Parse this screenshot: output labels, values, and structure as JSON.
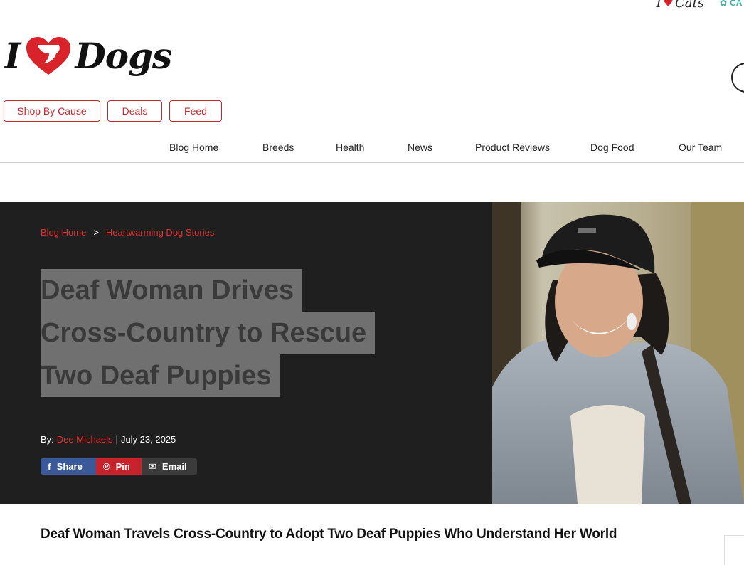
{
  "top_logos": {
    "cats_text": "Cats",
    "cat_brand_text": "CA"
  },
  "logo": {
    "left": "I",
    "right": "Dogs"
  },
  "pills": [
    "Shop By Cause",
    "Deals",
    "Feed"
  ],
  "nav": [
    "Blog Home",
    "Breeds",
    "Health",
    "News",
    "Product Reviews",
    "Dog Food",
    "Our Team"
  ],
  "breadcrumb": {
    "home": "Blog Home",
    "separator": ">",
    "category": "Heartwarming Dog Stories"
  },
  "article": {
    "title_lines": [
      "Deaf Woman Drives",
      "Cross-Country to Rescue",
      "Two Deaf Puppies"
    ],
    "by_label": "By:",
    "author": "Dee Michaels",
    "date_separator": "|",
    "date": "July 23, 2025",
    "subhead": "Deaf Woman Travels Cross-Country to Adopt Two Deaf Puppies Who Understand Her World"
  },
  "share": {
    "facebook": "Share",
    "pinterest": "Pin",
    "email": "Email"
  },
  "colors": {
    "brand_red": "#c8262d",
    "hero_bg": "#1f1f1f",
    "facebook": "#3b5998",
    "pinterest": "#c8232c"
  }
}
